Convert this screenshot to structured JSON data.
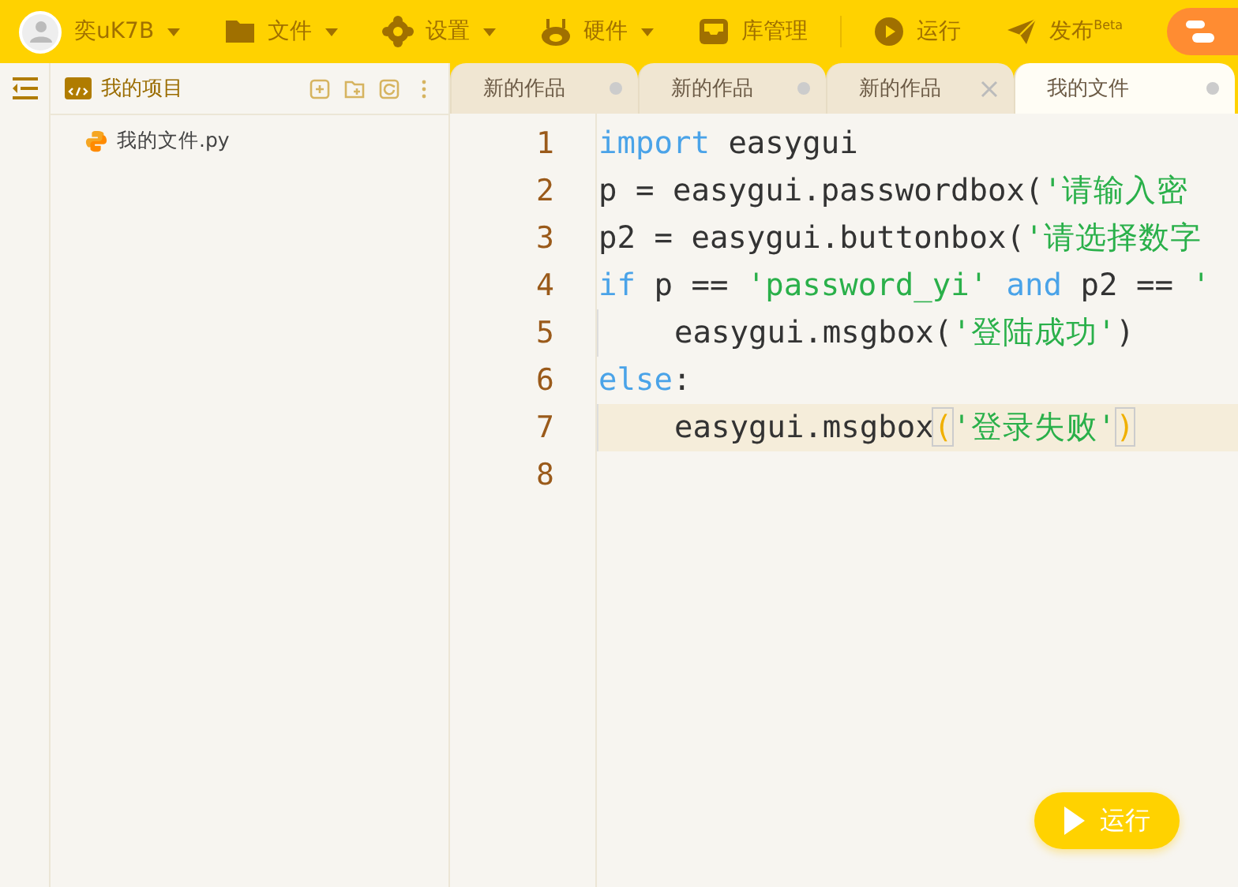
{
  "menu_bar": {
    "user": {
      "name": "奕uK7B",
      "dropdown": true
    },
    "items": [
      {
        "label": "文件",
        "dropdown": true
      },
      {
        "label": "设置",
        "dropdown": true
      },
      {
        "label": "硬件",
        "dropdown": true
      },
      {
        "label": "库管理",
        "dropdown": false
      },
      {
        "label": "运行",
        "dropdown": false
      },
      {
        "label": "发布$^{Beta}$",
        "dropdown": false
      }
    ]
  },
  "sidebar": {
    "title": "我的项目",
    "files": [
      {
        "name": "我的文件.py"
      }
    ]
  },
  "tabs": [
    {
      "label": "新的作品",
      "selected": false,
      "hovered": false
    },
    {
      "label": "新的作品",
      "selected": false,
      "hovered": false
    },
    {
      "label": "新的作品",
      "selected": false,
      "hovered": true
    },
    {
      "label": "我的文件",
      "selected": true,
      "hovered": false
    }
  ],
  "editor": {
    "lines": [
      {
        "number": "1",
        "current": false,
        "indent": false,
        "tokens": [
          {
            "kind": "kw",
            "text": "import"
          },
          {
            "kind": "plain",
            "text": " easygui"
          }
        ]
      },
      {
        "number": "2",
        "current": false,
        "indent": false,
        "tokens": [
          {
            "kind": "plain",
            "text": "p = easygui.passwordbox("
          },
          {
            "kind": "str",
            "text": "'请输入密"
          }
        ]
      },
      {
        "number": "3",
        "current": false,
        "indent": false,
        "tokens": [
          {
            "kind": "plain",
            "text": "p2 = easygui.buttonbox("
          },
          {
            "kind": "str",
            "text": "'请选择数字"
          }
        ]
      },
      {
        "number": "4",
        "current": false,
        "indent": false,
        "tokens": [
          {
            "kind": "kw",
            "text": "if"
          },
          {
            "kind": "plain",
            "text": " p == "
          },
          {
            "kind": "str",
            "text": "'password_yi'"
          },
          {
            "kind": "kw",
            "text": " and"
          },
          {
            "kind": "plain",
            "text": " p2 == "
          },
          {
            "kind": "str",
            "text": "'"
          }
        ]
      },
      {
        "number": "5",
        "current": false,
        "indent": true,
        "tokens": [
          {
            "kind": "plain",
            "text": "easygui.msgbox("
          },
          {
            "kind": "str",
            "text": "'登陆成功'"
          },
          {
            "kind": "plain",
            "text": ")"
          }
        ]
      },
      {
        "number": "6",
        "current": false,
        "indent": false,
        "tokens": [
          {
            "kind": "kw",
            "text": "else"
          },
          {
            "kind": "plain",
            "text": ":"
          }
        ]
      },
      {
        "number": "7",
        "current": true,
        "indent": true,
        "tokens": [
          {
            "kind": "plain",
            "text": "easygui.msgbox"
          },
          {
            "kind": "bracket",
            "text": "("
          },
          {
            "kind": "str",
            "text": "'登录失败'"
          },
          {
            "kind": "bracket",
            "text": ")"
          }
        ]
      },
      {
        "number": "8"
      }
    ]
  },
  "run_button": {
    "label": "运行"
  }
}
